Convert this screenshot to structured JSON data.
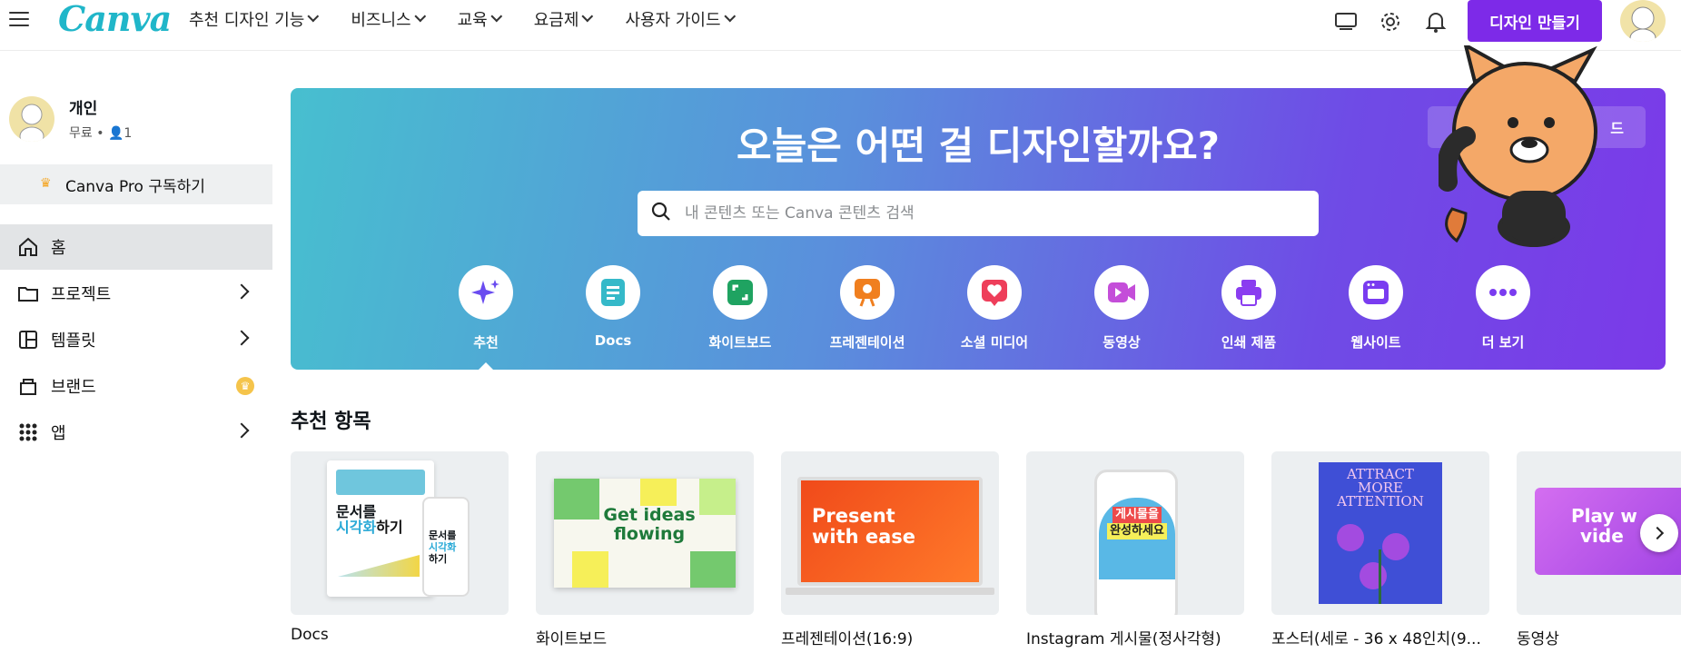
{
  "brand": {
    "logo_text": "Canva",
    "accent": "#7d2ae8",
    "teal": "#20b6c9"
  },
  "topnav": {
    "items": [
      {
        "label": "추천 디자인 기능"
      },
      {
        "label": "비즈니스"
      },
      {
        "label": "교육"
      },
      {
        "label": "요금제"
      },
      {
        "label": "사용자 가이드"
      }
    ],
    "icons": [
      "desktop-icon",
      "gear-icon",
      "bell-icon"
    ],
    "create_label": "디자인 만들기"
  },
  "sidebar": {
    "profile": {
      "name": "개인",
      "plan": "무료",
      "members": "1"
    },
    "pro_label": "Canva Pro 구독하기",
    "items": [
      {
        "label": "홈",
        "icon": "home-icon"
      },
      {
        "label": "프로젝트",
        "icon": "folder-icon"
      },
      {
        "label": "템플릿",
        "icon": "template-icon"
      },
      {
        "label": "브랜드",
        "icon": "brand-icon"
      },
      {
        "label": "앱",
        "icon": "apps-grid-icon"
      }
    ]
  },
  "hero": {
    "title": "오늘은 어떤 걸 디자인할까요?",
    "button_label": "드",
    "search_placeholder": "내 콘텐츠 또는 Canva 콘텐츠 검색",
    "categories": [
      {
        "label": "추천",
        "icon": "sparkle-icon",
        "color": "#6a4cf0"
      },
      {
        "label": "Docs",
        "icon": "doc-icon",
        "color": "#35b9c9"
      },
      {
        "label": "화이트보드",
        "icon": "whiteboard-icon",
        "color": "#1fa361"
      },
      {
        "label": "프레젠테이션",
        "icon": "presentation-icon",
        "color": "#f07f1f"
      },
      {
        "label": "소셜 미디어",
        "icon": "heart-icon",
        "color": "#ee3e5a"
      },
      {
        "label": "동영상",
        "icon": "video-icon",
        "color": "#c44ed9"
      },
      {
        "label": "인쇄 제품",
        "icon": "printer-icon",
        "color": "#8a3df0"
      },
      {
        "label": "웹사이트",
        "icon": "website-icon",
        "color": "#7a3cf0"
      },
      {
        "label": "더 보기",
        "icon": "more-icon",
        "color": "#7a3cf0"
      }
    ]
  },
  "recommended": {
    "title": "추천 항목",
    "cards": [
      {
        "label": "Docs",
        "thumb_texts": [
          "문서를",
          "시각화",
          "하기"
        ]
      },
      {
        "label": "화이트보드",
        "thumb_texts": [
          "Get ideas",
          "flowing"
        ]
      },
      {
        "label": "프레젠테이션(16:9)",
        "thumb_texts": [
          "Present",
          "with ease"
        ]
      },
      {
        "label": "Instagram 게시물(정사각형)",
        "thumb_texts": [
          "게시물을",
          "완성하세요"
        ]
      },
      {
        "label": "포스터(세로 - 36 x 48인치(9...",
        "thumb_texts": [
          "ATTRACT",
          "MORE",
          "ATTENTION"
        ]
      },
      {
        "label": "동영상",
        "thumb_texts": [
          "Play w",
          "vide"
        ]
      }
    ]
  }
}
